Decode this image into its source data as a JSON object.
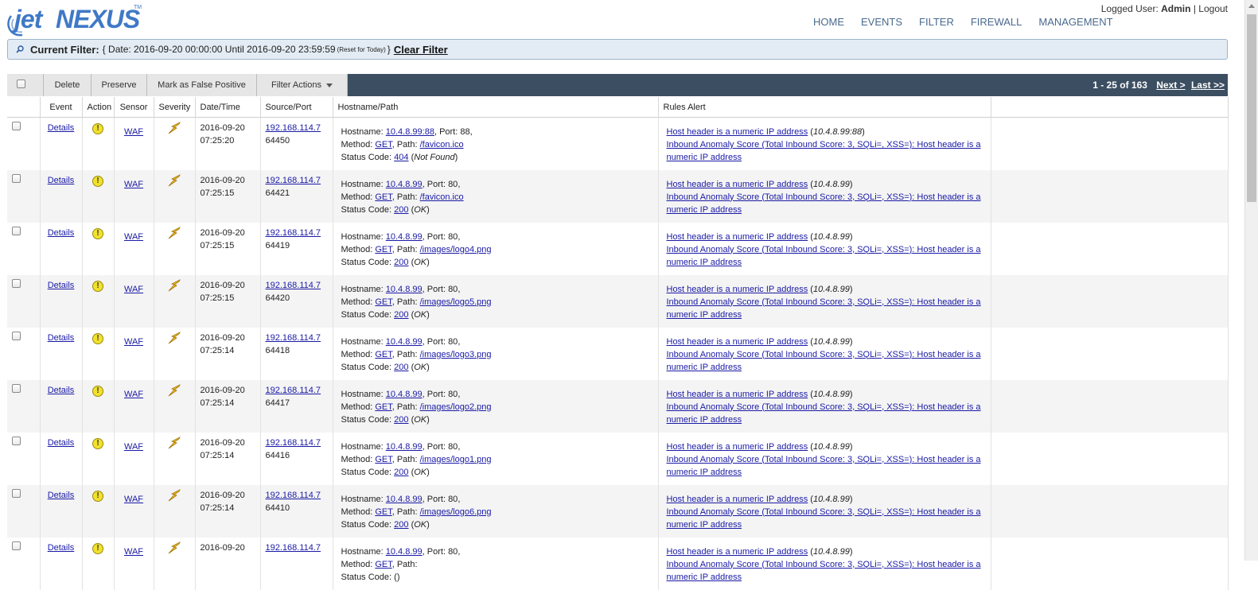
{
  "header": {
    "logo_jet": "jet",
    "logo_nexus": "NEXUS",
    "logo_tm": "TM",
    "nav": [
      "HOME",
      "EVENTS",
      "FILTER",
      "FIREWALL",
      "MANAGEMENT"
    ],
    "user_label": "Logged User:",
    "user_name": "Admin",
    "separator": "|",
    "logout": "Logout"
  },
  "filter": {
    "label": "Current Filter:",
    "open_brace": "{",
    "text": "Date: 2016-09-20 00:00:00 Until 2016-09-20 23:59:59",
    "reset": "(Reset for Today)",
    "close_brace": "}",
    "clear": "Clear Filter"
  },
  "toolbar": {
    "delete": "Delete",
    "preserve": "Preserve",
    "false_positive": "Mark as False Positive",
    "filter_actions": "Filter Actions",
    "paging": "1 - 25 of 163",
    "next": "Next >",
    "last": "Last >>"
  },
  "columns": [
    "Event",
    "Action",
    "Sensor",
    "Severity",
    "Date/Time",
    "Source/Port",
    "Hostname/Path",
    "Rules Alert"
  ],
  "row_labels": {
    "details": "Details",
    "sensor": "WAF",
    "hostname": "Hostname:",
    "port": "Port:",
    "method": "Method:",
    "path": "Path:",
    "status": "Status Code:",
    "rule1": "Host header is a numeric IP address",
    "rule2": "Inbound Anomaly Score (Total Inbound Score: 3, SQLi=, XSS=): Host header is a numeric IP address"
  },
  "rows": [
    {
      "date": "2016-09-20",
      "time": "07:25:20",
      "src_ip": "192.168.114.7",
      "src_port": "64450",
      "host": "10.4.8.99:88",
      "port": "88",
      "method": "GET",
      "path": "/favicon.ico",
      "code": "404",
      "code_text": "Not Found",
      "rule_host": "10.4.8.99:88"
    },
    {
      "date": "2016-09-20",
      "time": "07:25:15",
      "src_ip": "192.168.114.7",
      "src_port": "64421",
      "host": "10.4.8.99",
      "port": "80",
      "method": "GET",
      "path": "/favicon.ico",
      "code": "200",
      "code_text": "OK",
      "rule_host": "10.4.8.99"
    },
    {
      "date": "2016-09-20",
      "time": "07:25:15",
      "src_ip": "192.168.114.7",
      "src_port": "64419",
      "host": "10.4.8.99",
      "port": "80",
      "method": "GET",
      "path": "/images/logo4.png",
      "code": "200",
      "code_text": "OK",
      "rule_host": "10.4.8.99"
    },
    {
      "date": "2016-09-20",
      "time": "07:25:15",
      "src_ip": "192.168.114.7",
      "src_port": "64420",
      "host": "10.4.8.99",
      "port": "80",
      "method": "GET",
      "path": "/images/logo5.png",
      "code": "200",
      "code_text": "OK",
      "rule_host": "10.4.8.99"
    },
    {
      "date": "2016-09-20",
      "time": "07:25:14",
      "src_ip": "192.168.114.7",
      "src_port": "64418",
      "host": "10.4.8.99",
      "port": "80",
      "method": "GET",
      "path": "/images/logo3.png",
      "code": "200",
      "code_text": "OK",
      "rule_host": "10.4.8.99"
    },
    {
      "date": "2016-09-20",
      "time": "07:25:14",
      "src_ip": "192.168.114.7",
      "src_port": "64417",
      "host": "10.4.8.99",
      "port": "80",
      "method": "GET",
      "path": "/images/logo2.png",
      "code": "200",
      "code_text": "OK",
      "rule_host": "10.4.8.99"
    },
    {
      "date": "2016-09-20",
      "time": "07:25:14",
      "src_ip": "192.168.114.7",
      "src_port": "64416",
      "host": "10.4.8.99",
      "port": "80",
      "method": "GET",
      "path": "/images/logo1.png",
      "code": "200",
      "code_text": "OK",
      "rule_host": "10.4.8.99"
    },
    {
      "date": "2016-09-20",
      "time": "07:25:14",
      "src_ip": "192.168.114.7",
      "src_port": "64410",
      "host": "10.4.8.99",
      "port": "80",
      "method": "GET",
      "path": "/images/logo6.png",
      "code": "200",
      "code_text": "OK",
      "rule_host": "10.4.8.99"
    },
    {
      "date": "2016-09-20",
      "time": "",
      "src_ip": "192.168.114.7",
      "src_port": "",
      "host": "10.4.8.99",
      "port": "80",
      "method": "GET",
      "path": "",
      "code": "",
      "code_text": "",
      "rule_host": "10.4.8.99"
    }
  ],
  "icons": {
    "action": "warning-icon",
    "severity": "lightning-icon",
    "filter": "search-icon"
  },
  "colors": {
    "link": "#1a1aa6",
    "toolbar": "#3c4e61",
    "filterbar": "#e3ecf4",
    "warning": "#f2e12c",
    "severity": "#e8b820"
  }
}
